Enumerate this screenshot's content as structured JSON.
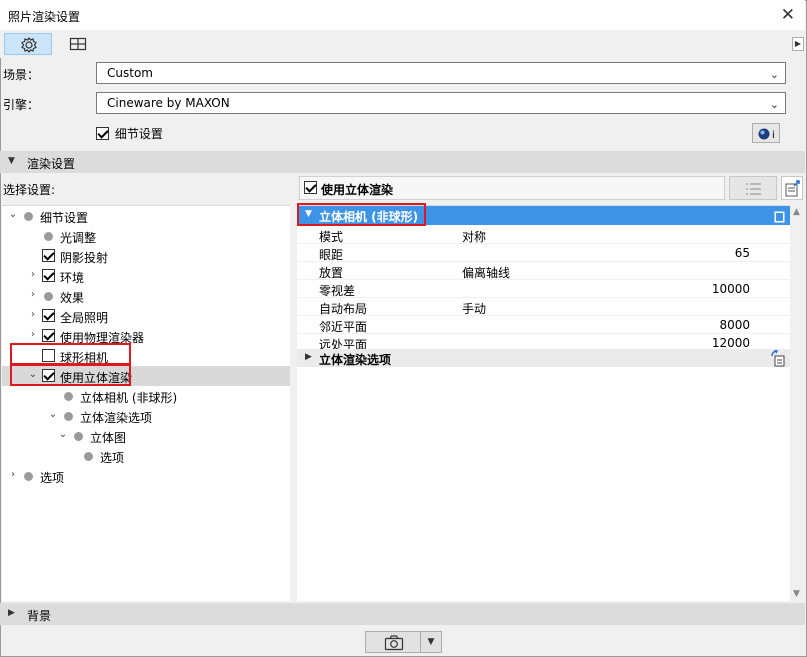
{
  "window": {
    "title": "照片渲染设置"
  },
  "toolbar": {
    "settings_icon": "gear-icon",
    "layout_icon": "grid-icon"
  },
  "scene": {
    "label": "场景：",
    "value": "Custom"
  },
  "engine": {
    "label": "引擎：",
    "value": "Cineware by MAXON"
  },
  "detail_settings": {
    "label": "细节设置",
    "checked": true
  },
  "render_settings": {
    "title": "渲染设置"
  },
  "select_settings": {
    "label": "选择设置:"
  },
  "stereo_header": {
    "label": "使用立体渲染",
    "checked": true
  },
  "tree": [
    {
      "label": "细节设置",
      "expander": "open",
      "kind": "dot",
      "level": 0
    },
    {
      "label": "光调整",
      "expander": "none",
      "kind": "dot",
      "level": 1
    },
    {
      "label": "阴影投射",
      "expander": "none",
      "kind": "checkbox",
      "checked": true,
      "level": 1
    },
    {
      "label": "环境",
      "expander": "closed",
      "kind": "checkbox",
      "checked": true,
      "level": 1
    },
    {
      "label": "效果",
      "expander": "closed",
      "kind": "dot",
      "level": 1
    },
    {
      "label": "全局照明",
      "expander": "closed",
      "kind": "checkbox",
      "checked": true,
      "level": 1
    },
    {
      "label": "使用物理渲染器",
      "expander": "closed",
      "kind": "checkbox",
      "checked": true,
      "level": 1
    },
    {
      "label": "球形相机",
      "expander": "none",
      "kind": "checkbox",
      "checked": false,
      "level": 1
    },
    {
      "label": "使用立体渲染",
      "expander": "open",
      "kind": "checkbox",
      "checked": true,
      "level": 1,
      "selected": true
    },
    {
      "label": "立体相机 (非球形)",
      "expander": "none",
      "kind": "dot",
      "level": 2
    },
    {
      "label": "立体渲染选项",
      "expander": "open",
      "kind": "dot",
      "level": 2
    },
    {
      "label": "立体图",
      "expander": "open",
      "kind": "dot",
      "level": 3
    },
    {
      "label": "选项",
      "expander": "none",
      "kind": "dot",
      "level": 4
    },
    {
      "label": "选项",
      "expander": "closed",
      "kind": "dot",
      "level": 0
    }
  ],
  "camera_group": {
    "title": "立体相机 (非球形)"
  },
  "properties": [
    {
      "name": "模式",
      "text": "对称",
      "number": ""
    },
    {
      "name": "眼距",
      "text": "",
      "number": "65"
    },
    {
      "name": "放置",
      "text": "偏离轴线",
      "number": ""
    },
    {
      "name": "零视差",
      "text": "",
      "number": "10000"
    },
    {
      "name": "自动布局",
      "text": "手动",
      "number": ""
    },
    {
      "name": "邻近平面",
      "text": "",
      "number": "8000"
    },
    {
      "name": "远处平面",
      "text": "",
      "number": "12000"
    }
  ],
  "options_group": {
    "title": "立体渲染选项"
  },
  "background": {
    "title": "背景"
  },
  "colors": {
    "selection_blue": "#3d94e6",
    "highlight_red": "#e0191f",
    "tree_selected": "#d9d9d9"
  }
}
